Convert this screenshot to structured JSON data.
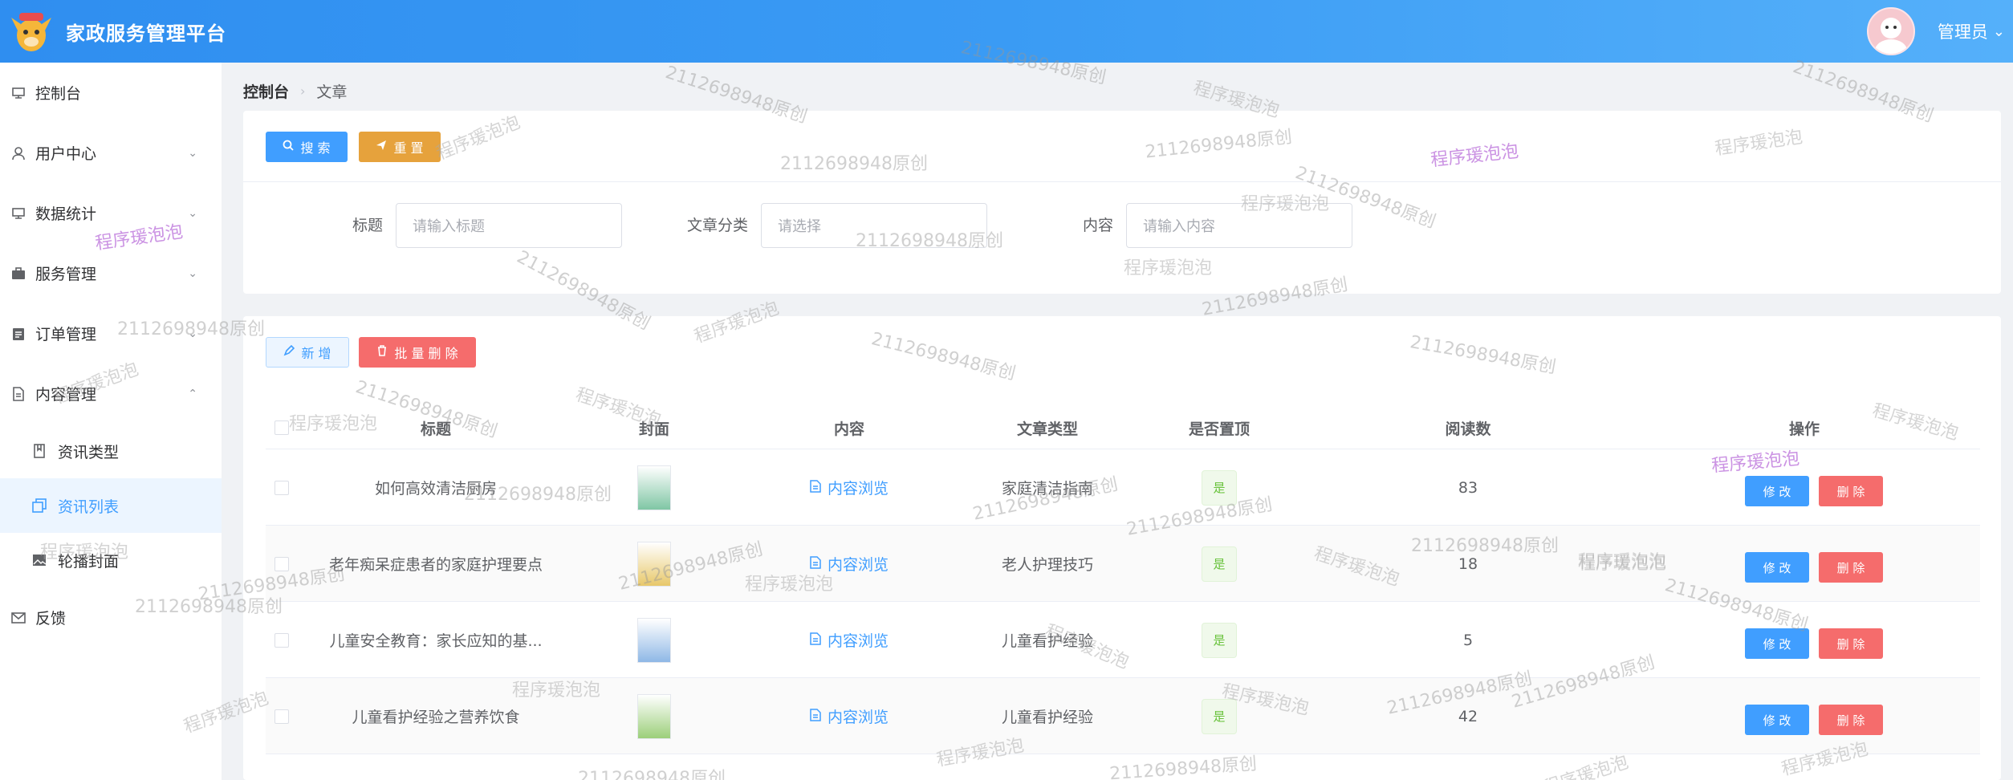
{
  "header": {
    "app_title": "家政服务管理平台",
    "admin_name": "管理员"
  },
  "sidebar": {
    "items": [
      {
        "label": "控制台",
        "icon": "dashboard-icon"
      },
      {
        "label": "用户中心",
        "icon": "user-icon"
      },
      {
        "label": "数据统计",
        "icon": "chart-icon"
      },
      {
        "label": "服务管理",
        "icon": "briefcase-icon"
      },
      {
        "label": "订单管理",
        "icon": "clipboard-icon"
      },
      {
        "label": "内容管理",
        "icon": "document-icon"
      }
    ],
    "submenu": [
      {
        "label": "资讯类型",
        "icon": "book-icon"
      },
      {
        "label": "资讯列表",
        "icon": "copy-icon",
        "active": true
      },
      {
        "label": "轮播封面",
        "icon": "picture-icon"
      }
    ],
    "feedback": {
      "label": "反馈",
      "icon": "mail-icon"
    }
  },
  "breadcrumb": {
    "root": "控制台",
    "current": "文章"
  },
  "search": {
    "search_label": "搜 索",
    "reset_label": "重 置",
    "title_label": "标题",
    "title_placeholder": "请输入标题",
    "category_label": "文章分类",
    "category_placeholder": "请选择",
    "content_label": "内容",
    "content_placeholder": "请输入内容"
  },
  "toolbar": {
    "add_label": "新 增",
    "batch_delete_label": "批 量 删 除"
  },
  "table": {
    "columns": [
      "标题",
      "封面",
      "内容",
      "文章类型",
      "是否置顶",
      "阅读数",
      "操作"
    ],
    "rows": [
      {
        "title": "如何高效清洁厨房",
        "content_link": "内容浏览",
        "type": "家庭清洁指南",
        "pinned": "是",
        "reads": "83",
        "cover_color": "#7fc6a4"
      },
      {
        "title": "老年痴呆症患者的家庭护理要点",
        "content_link": "内容浏览",
        "type": "老人护理技巧",
        "pinned": "是",
        "reads": "18",
        "cover_color": "#e8c86a"
      },
      {
        "title": "儿童安全教育：家长应知的基...",
        "content_link": "内容浏览",
        "type": "儿童看护经验",
        "pinned": "是",
        "reads": "5",
        "cover_color": "#8fb8e6"
      },
      {
        "title": "儿童看护经验之营养饮食",
        "content_link": "内容浏览",
        "type": "儿童看护经验",
        "pinned": "是",
        "reads": "42",
        "cover_color": "#9ccf7a"
      }
    ],
    "edit_label": "修 改",
    "delete_label": "删 除"
  },
  "watermarks": {
    "purple": "程序瑗泡泡",
    "number": "2112698948原创"
  }
}
